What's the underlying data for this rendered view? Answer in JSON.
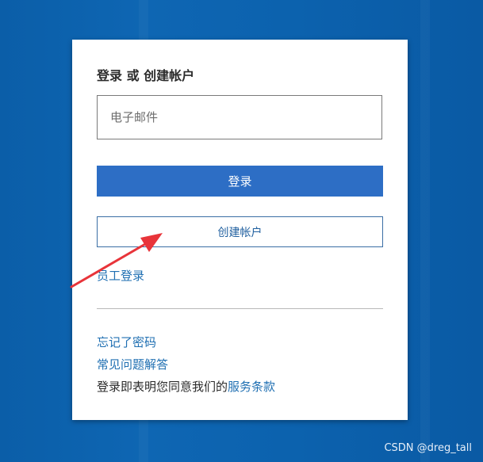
{
  "login_card": {
    "title": "登录 或 创建帐户",
    "email_placeholder": "电子邮件",
    "login_button_label": "登录",
    "create_account_label": "创建帐户",
    "employee_login_link": "员工登录",
    "forgot_password_link": "忘记了密码",
    "faq_link": "常见问题解答",
    "terms_prefix": "登录即表明您同意我们的",
    "terms_link": "服务条款"
  },
  "watermark": {
    "text": "CSDN @dreg_tall"
  },
  "colors": {
    "background": "#0c62ae",
    "primary_button": "#2d6ec5",
    "link": "#1f6fb2",
    "annotation_arrow": "#e8343a"
  },
  "annotation": {
    "icon": "red-arrow-icon"
  }
}
